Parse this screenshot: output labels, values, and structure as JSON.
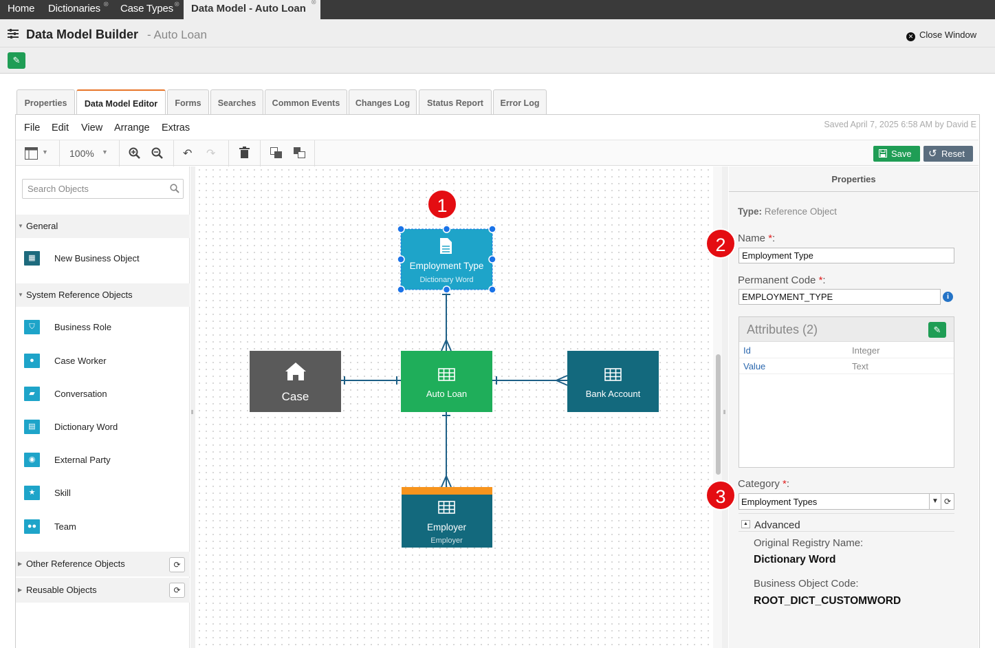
{
  "nav": {
    "tabs": [
      {
        "label": "Home"
      },
      {
        "label": "Dictionaries"
      },
      {
        "label": "Case Types"
      },
      {
        "label": "Data Model - Auto Loan"
      }
    ]
  },
  "header": {
    "title": "Data Model Builder",
    "subtitle": "- Auto Loan",
    "close_label": "Close Window"
  },
  "tabs": [
    {
      "label": "Properties"
    },
    {
      "label": "Data Model Editor",
      "active": true
    },
    {
      "label": "Forms"
    },
    {
      "label": "Searches"
    },
    {
      "label": "Common Events"
    },
    {
      "label": "Changes Log"
    },
    {
      "label": "Status Report"
    },
    {
      "label": "Error Log"
    }
  ],
  "menu": [
    "File",
    "Edit",
    "View",
    "Arrange",
    "Extras"
  ],
  "saved_text": "Saved April 7, 2025 6:58 AM by David E",
  "toolbar": {
    "zoom": "100%",
    "save_label": "Save",
    "reset_label": "Reset"
  },
  "sidebar": {
    "search_placeholder": "Search Objects",
    "general_label": "General",
    "general_items": [
      {
        "label": "New Business Object",
        "icon": "table-icon"
      }
    ],
    "system_label": "System Reference Objects",
    "system_items": [
      {
        "label": "Business Role",
        "icon": "shield-icon"
      },
      {
        "label": "Case Worker",
        "icon": "user-icon"
      },
      {
        "label": "Conversation",
        "icon": "book-icon"
      },
      {
        "label": "Dictionary Word",
        "icon": "document-icon"
      },
      {
        "label": "External Party",
        "icon": "globe-icon"
      },
      {
        "label": "Skill",
        "icon": "star-icon"
      },
      {
        "label": "Team",
        "icon": "users-icon"
      }
    ],
    "other_label": "Other Reference Objects",
    "reusable_label": "Reusable Objects"
  },
  "diagram": {
    "nodes": {
      "employment_type": {
        "title": "Employment Type",
        "subtitle": "Dictionary Word",
        "color": "#1ea4c9"
      },
      "auto_loan": {
        "title": "Auto Loan",
        "color": "#1fae5a"
      },
      "case": {
        "title": "Case",
        "color": "#5a5a5a"
      },
      "bank_account": {
        "title": "Bank Account",
        "color": "#13697d"
      },
      "employer": {
        "title": "Employer",
        "subtitle": "Employer",
        "color": "#13697d",
        "accent": "#f7941d"
      }
    },
    "badges": [
      "1",
      "2",
      "3"
    ]
  },
  "properties": {
    "header": "Properties",
    "type_label": "Type:",
    "type_value": "Reference Object",
    "name_label": "Name",
    "name_value": "Employment Type",
    "code_label": "Permanent Code",
    "code_value": "EMPLOYMENT_TYPE",
    "attributes_title": "Attributes (2)",
    "attributes": [
      {
        "name": "Id",
        "type": "Integer"
      },
      {
        "name": "Value",
        "type": "Text"
      }
    ],
    "category_label": "Category",
    "category_value": "Employment Types",
    "advanced_label": "Advanced",
    "registry_label": "Original Registry Name:",
    "registry_value": "Dictionary Word",
    "bo_code_label": "Business Object Code:",
    "bo_code_value": "ROOT_DICT_CUSTOMWORD"
  }
}
